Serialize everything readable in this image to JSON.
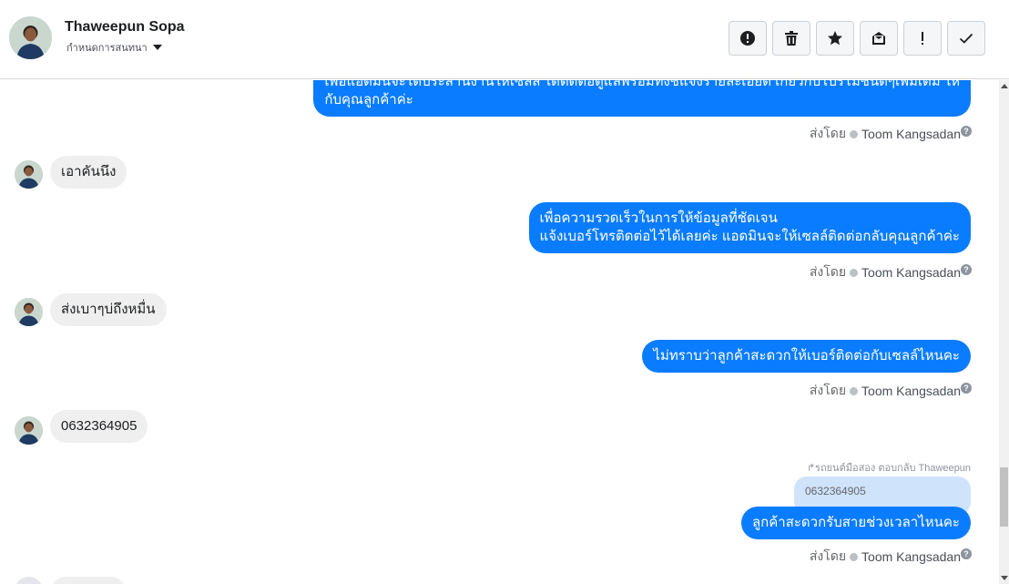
{
  "header": {
    "contact_name": "Thaweepun Sopa",
    "assign_label": "กำหนดการสนทนา",
    "toolbar": {
      "spam_icon": "alert-circle-icon",
      "delete_icon": "trash-icon",
      "star_icon": "star-icon",
      "unread_icon": "envelope-icon",
      "important_icon": "exclamation-icon",
      "done_icon": "check-icon"
    }
  },
  "messages": [
    {
      "dir": "out",
      "lines": [
        "เพื่อแอดมินจะได้ประสานงานให้เซลส์ ได้ติดต่อดูแลพร้อมทั้งชี้แจงรายละเอียด เกี่ยวกับโปรโมชั่นดีๆเพิ่มเติม ให้",
        "กับคุณลูกค้าค่ะ"
      ],
      "sent_by_label": "ส่งโดย",
      "agent": "Toom Kangsadan"
    },
    {
      "dir": "in",
      "text": "เอาคันนึง"
    },
    {
      "dir": "out",
      "lines": [
        "เพื่อความรวดเร็วในการให้ข้อมูลที่ชัดเจน",
        "แจ้งเบอร์โทรติดต่อไว้ได้เลยค่ะ แอดมินจะให้เซลล์ติดต่อกลับคุณลูกค้าค่ะ"
      ],
      "sent_by_label": "ส่งโดย",
      "agent": "Toom Kangsadan"
    },
    {
      "dir": "in",
      "text": "ส่งเบาๆบ่ถึงหมื่น"
    },
    {
      "dir": "out",
      "lines": [
        "ไม่ทราบว่าลูกค้าสะดวกให้เบอร์ติดต่อกับเซลล์ไหนคะ"
      ],
      "sent_by_label": "ส่งโดย",
      "agent": "Toom Kangsadan"
    },
    {
      "dir": "in",
      "text": "0632364905"
    },
    {
      "dir": "out",
      "reply_meta": "รถยนต์มือสอง ตอบกลับ Thaweepun",
      "quoted": "0632364905",
      "lines": [
        "ลูกค้าสะดวกรับสายช่วงเวลาไหนคะ"
      ],
      "sent_by_label": "ส่งโดย",
      "agent": "Toom Kangsadan"
    }
  ],
  "colors": {
    "outgoing": "#0a7cff",
    "incoming": "#efefef",
    "quoted": "#cfe3fb"
  }
}
